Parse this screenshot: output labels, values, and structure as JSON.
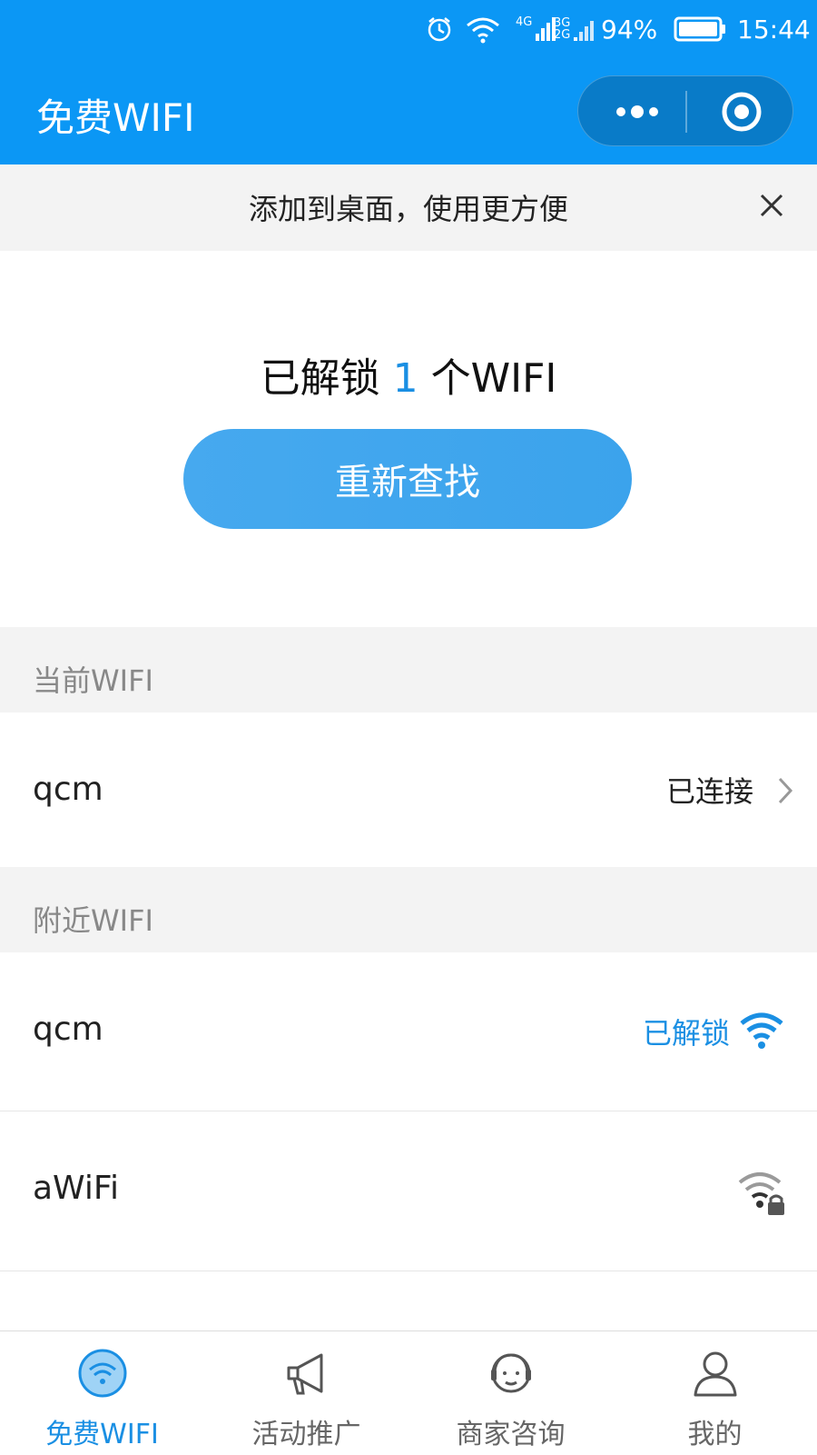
{
  "status_bar": {
    "battery_percent": "94%",
    "time": "15:44",
    "network_4g": "4G",
    "network_3g": "3G",
    "network_2g": "2G"
  },
  "nav": {
    "title": "免费WIFI"
  },
  "banner": {
    "text": "添加到桌面，使用更方便"
  },
  "hero": {
    "prefix": "已解锁",
    "count": "1",
    "suffix": "个WIFI",
    "button_label": "重新查找"
  },
  "current_section": {
    "title": "当前WIFI",
    "items": [
      {
        "ssid": "qcm",
        "status": "已连接"
      }
    ]
  },
  "nearby_section": {
    "title": "附近WIFI",
    "items": [
      {
        "ssid": "qcm",
        "status": "已解锁",
        "icon": "wifi-signal-icon"
      },
      {
        "ssid": "aWiFi",
        "status": "",
        "icon": "wifi-locked-icon"
      }
    ]
  },
  "tabbar": {
    "tabs": [
      {
        "label": "免费WIFI",
        "icon": "wifi-tab-icon",
        "active": true
      },
      {
        "label": "活动推广",
        "icon": "megaphone-icon",
        "active": false
      },
      {
        "label": "商家咨询",
        "icon": "customer-service-icon",
        "active": false
      },
      {
        "label": "我的",
        "icon": "user-icon",
        "active": false
      }
    ]
  },
  "colors": {
    "brand": "#0b97f5",
    "accent": "#1a8fe3",
    "button": "#3ba3ec"
  }
}
